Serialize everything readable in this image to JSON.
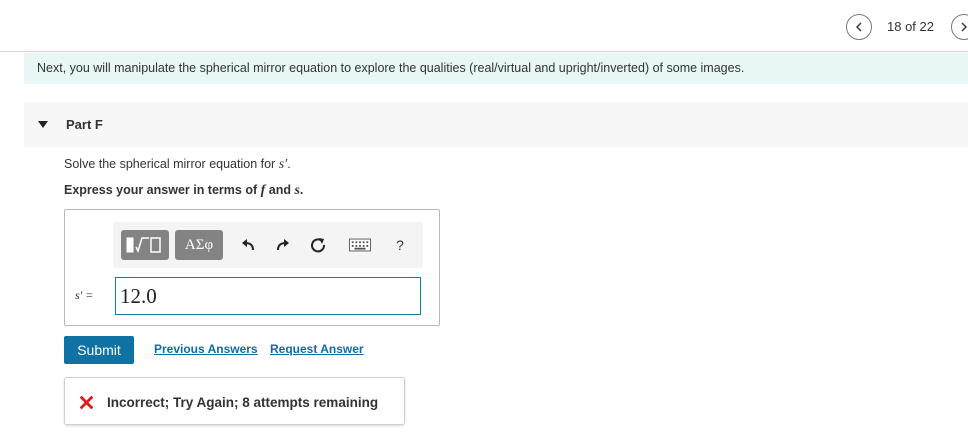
{
  "nav": {
    "counter": "18 of 22",
    "prev_icon": "chevron-left-icon",
    "next_icon": "chevron-right-icon"
  },
  "intro": {
    "text": "Next, you will manipulate the spherical mirror equation to explore the qualities (real/virtual and upright/inverted) of some images."
  },
  "part": {
    "title": "Part F",
    "question_prefix": "Solve the spherical mirror equation for ",
    "question_var": "s′",
    "question_suffix": ".",
    "instruction_prefix": "Express your answer in terms of ",
    "instruction_var1": "f",
    "instruction_mid": " and ",
    "instruction_var2": "s",
    "instruction_suffix": "."
  },
  "toolbar": {
    "greek_label": "ΑΣφ",
    "help_label": "?",
    "icons": [
      "templates-icon",
      "greek-letters-icon",
      "undo-icon",
      "redo-icon",
      "reset-icon",
      "keyboard-icon",
      "help-icon"
    ]
  },
  "answer": {
    "label": "s′ =",
    "value": "12.0"
  },
  "actions": {
    "submit_label": "Submit",
    "previous_answers_label": "Previous Answers",
    "request_answer_label": "Request Answer"
  },
  "feedback": {
    "text": "Incorrect; Try Again; 8 attempts remaining",
    "icon": "x-icon"
  },
  "colors": {
    "intro_bg": "#e8f6f6",
    "accent": "#0f72a2",
    "link": "#0f6ba6",
    "error": "#d91c1c",
    "input_border": "#0d7d9b"
  }
}
